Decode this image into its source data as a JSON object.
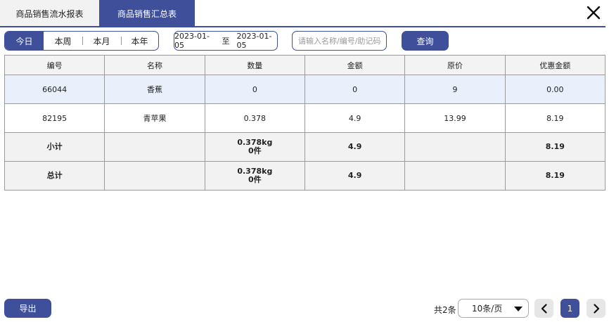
{
  "tabs": [
    {
      "label": "商品销售流水报表"
    },
    {
      "label": "商品销售汇总表"
    }
  ],
  "periods": [
    "今日",
    "本周",
    "本月",
    "本年"
  ],
  "date_range": {
    "start": "2023-01-05",
    "sep": "至",
    "end": "2023-01-05"
  },
  "search": {
    "placeholder": "请输入名称/编号/助记码",
    "value": ""
  },
  "query_label": "查询",
  "table": {
    "headers": [
      "编号",
      "名称",
      "数量",
      "金额",
      "原价",
      "优惠金额"
    ],
    "rows": [
      [
        "66044",
        "香蕉",
        "0",
        "0",
        "9",
        "0.00"
      ],
      [
        "82195",
        "青苹果",
        "0.378",
        "4.9",
        "13.99",
        "8.19"
      ]
    ],
    "subtotal": {
      "label": "小计",
      "name": "",
      "qty_line1": "0.378kg",
      "qty_line2": "0件",
      "amount": "4.9",
      "price": "",
      "discount": "8.19"
    },
    "total": {
      "label": "总计",
      "name": "",
      "qty_line1": "0.378kg",
      "qty_line2": "0件",
      "amount": "4.9",
      "price": "",
      "discount": "8.19"
    }
  },
  "footer": {
    "export_label": "导出",
    "total_text": "共2条",
    "page_size": "10条/页",
    "current_page": "1"
  },
  "colors": {
    "accent": "#3f4f9a",
    "highlight_row": "#eaf0fb"
  }
}
